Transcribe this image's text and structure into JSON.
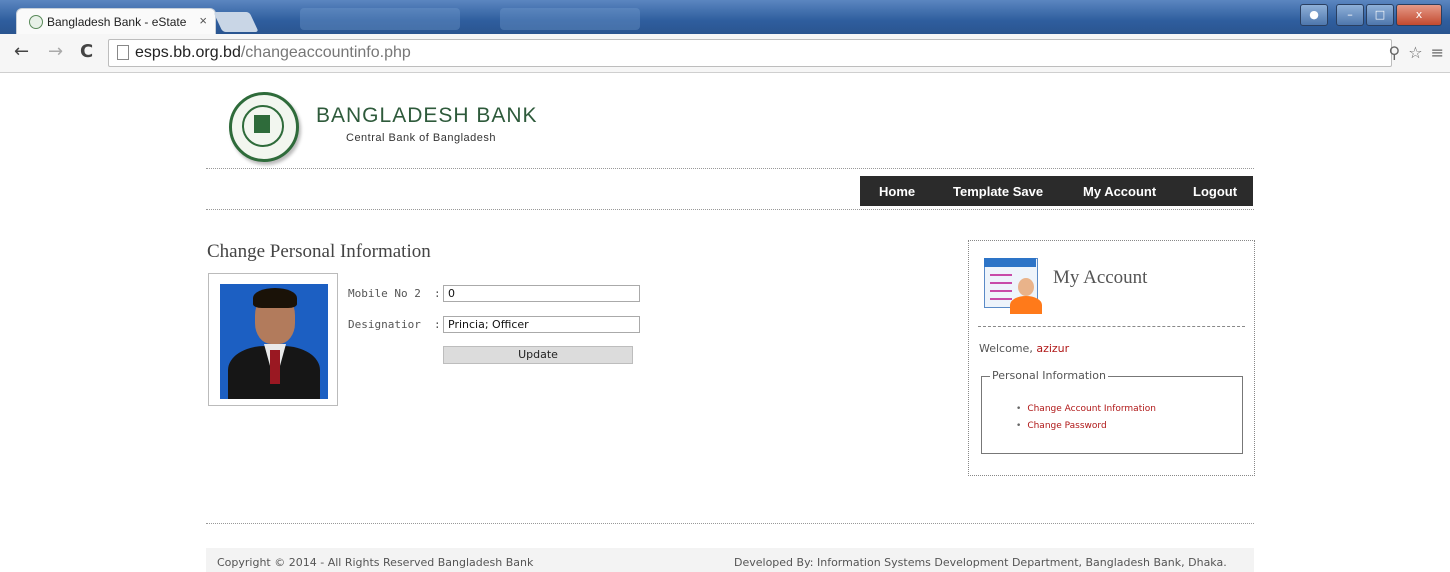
{
  "browser": {
    "tab_title": "Bangladesh Bank - eState",
    "tab_close": "×",
    "url_host": "esps.bb.org.bd",
    "url_path": "/changeaccountinfo.php",
    "nav": {
      "back": "←",
      "forward": "→",
      "reload": "C"
    },
    "toolbar_icons": {
      "zoom": "⚲",
      "star": "☆",
      "menu": "≡"
    },
    "window": {
      "minimize": "–",
      "maximize": "□",
      "close": "x"
    }
  },
  "header": {
    "bank_name": "BANGLADESH BANK",
    "tagline": "Central Bank of Bangladesh"
  },
  "nav": {
    "items": [
      "Home",
      "Template Save",
      "My Account",
      "Logout"
    ]
  },
  "main": {
    "title": "Change Personal Information",
    "form": {
      "mobile_label": "Mobile No 2",
      "mobile_value": "0",
      "designation_label": "Designatior",
      "designation_value": "Princia; Officer",
      "colon": ":",
      "update_label": "Update"
    }
  },
  "sidebar": {
    "title": "My Account",
    "welcome_prefix": "Welcome,",
    "username": "azizur",
    "section_title": "Personal Information",
    "links": [
      "Change Account Information",
      "Change Password"
    ]
  },
  "footer": {
    "copyright": "Copyright © 2014 - All Rights Reserved Bangladesh Bank",
    "developed_by": "Developed By: Information Systems Development Department, Bangladesh Bank, Dhaka."
  },
  "colors": {
    "nav_bg": "#2b2b2b",
    "link_red": "#b01818",
    "brand_green": "#2e5a3b"
  }
}
